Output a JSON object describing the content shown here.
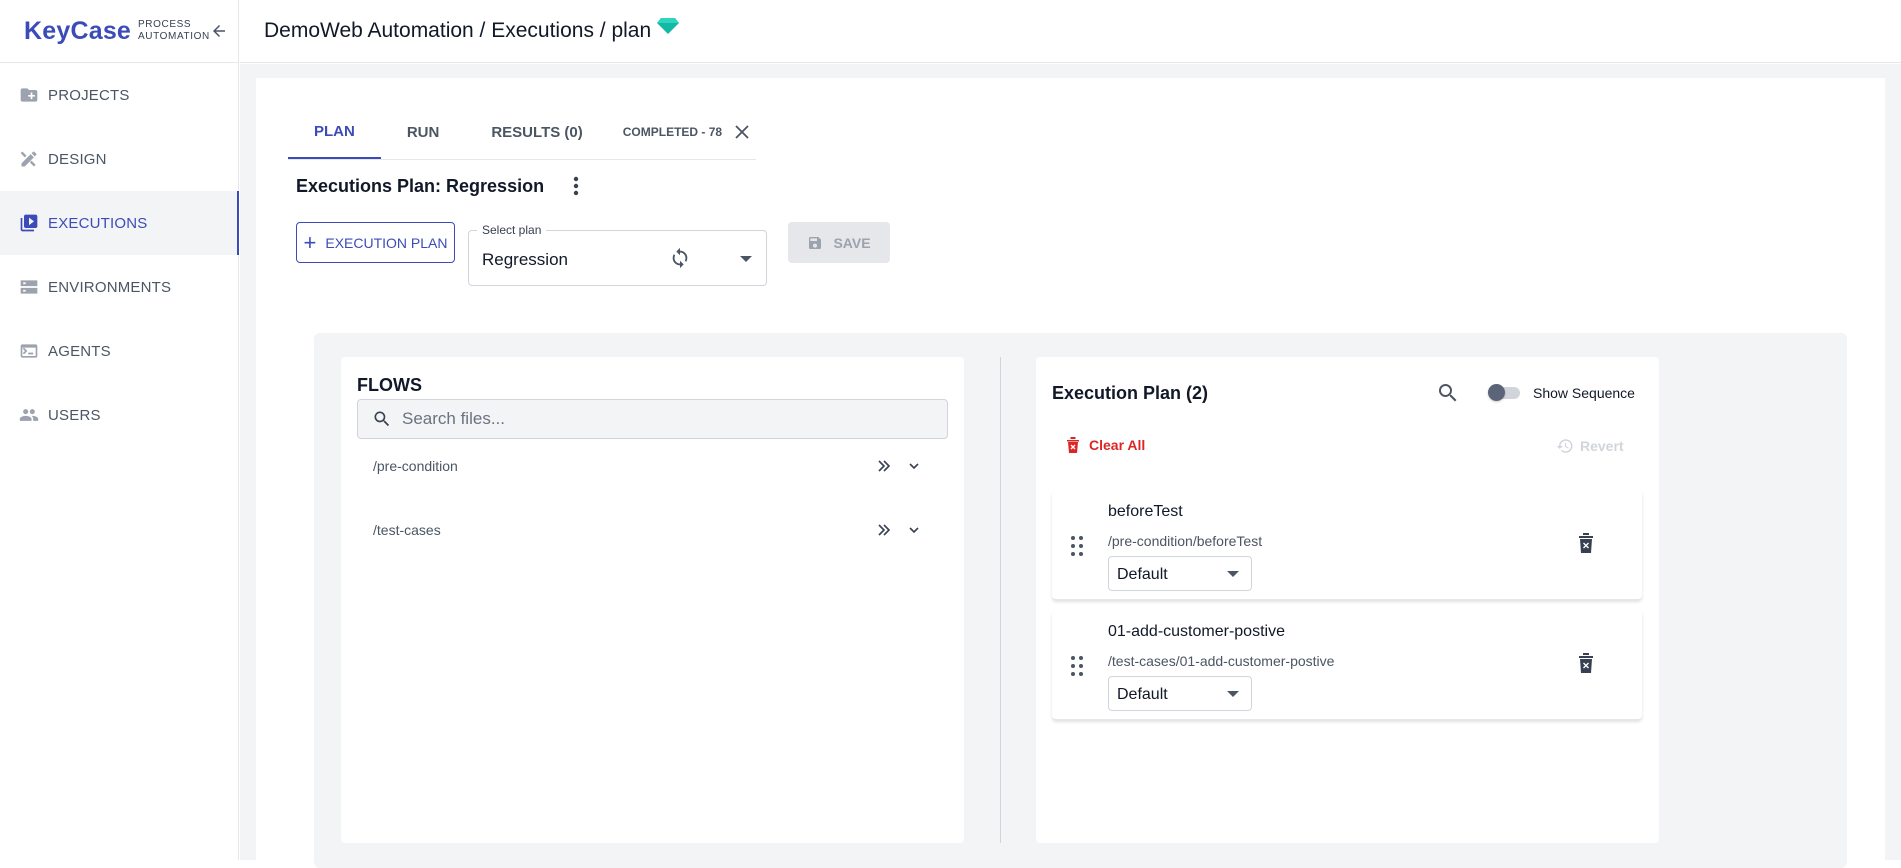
{
  "brand": {
    "name": "KeyCase",
    "sub_line1": "PROCESS",
    "sub_line2": "AUTOMATION"
  },
  "sidebar": {
    "items": [
      {
        "label": "PROJECTS",
        "icon": "folder-plus-icon",
        "active": false
      },
      {
        "label": "DESIGN",
        "icon": "design-tools-icon",
        "active": false
      },
      {
        "label": "EXECUTIONS",
        "icon": "play-library-icon",
        "active": true
      },
      {
        "label": "ENVIRONMENTS",
        "icon": "server-icon",
        "active": false
      },
      {
        "label": "AGENTS",
        "icon": "terminal-icon",
        "active": false
      },
      {
        "label": "USERS",
        "icon": "people-icon",
        "active": false
      }
    ]
  },
  "header": {
    "breadcrumb": "DemoWeb Automation / Executions / plan",
    "gem_icon": "diamond-icon",
    "gem_color": "#14b8a6"
  },
  "tabs": {
    "items": [
      "PLAN",
      "RUN",
      "RESULTS (0)"
    ],
    "active": "PLAN",
    "completed_label": "COMPLETED - 78"
  },
  "plan": {
    "title": "Executions Plan: Regression",
    "new_button": "EXECUTION PLAN",
    "select_label": "Select plan",
    "select_value": "Regression",
    "save_button": "SAVE"
  },
  "flows": {
    "title": "FLOWS",
    "search_placeholder": "Search files...",
    "folders": [
      "/pre-condition",
      "/test-cases"
    ]
  },
  "execution_plan": {
    "title": "Execution Plan (2)",
    "toggle_label": "Show Sequence",
    "toggle_on": false,
    "clear_all": "Clear All",
    "revert": "Revert",
    "items": [
      {
        "name": "beforeTest",
        "path": "/pre-condition/beforeTest",
        "env": "Default"
      },
      {
        "name": "01-add-customer-postive",
        "path": "/test-cases/01-add-customer-postive",
        "env": "Default"
      }
    ]
  },
  "colors": {
    "accent": "#3b4cb8",
    "danger": "#dc2626",
    "muted": "#9ca3af"
  }
}
